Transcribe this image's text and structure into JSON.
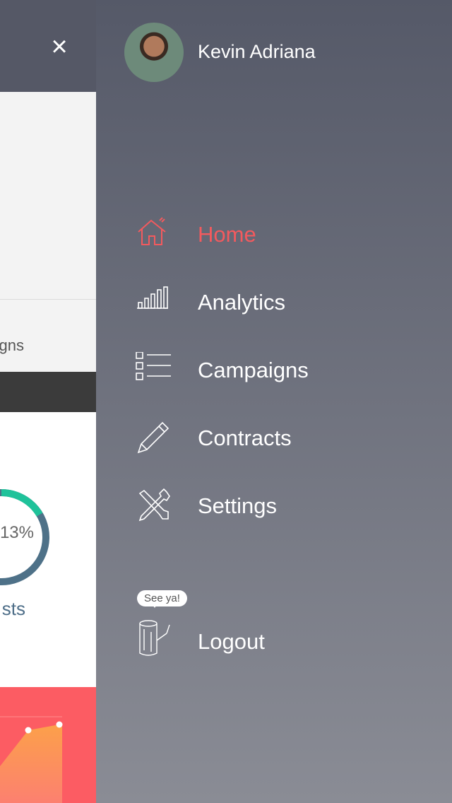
{
  "left_panel": {
    "close_icon": "×",
    "tab_partial": "gns",
    "chevron": ">",
    "donut_percent": "13%",
    "donut_progress": 0.13,
    "donut_label_partial": "sts",
    "colors": {
      "teal": "#1fc29a",
      "ring": "#4e7188",
      "red": "#fc5c63"
    }
  },
  "user": {
    "name": "Kevin Adriana"
  },
  "menu": {
    "items": [
      {
        "label": "Home",
        "icon": "home-icon",
        "active": true
      },
      {
        "label": "Analytics",
        "icon": "bar-chart-icon"
      },
      {
        "label": "Campaigns",
        "icon": "list-icon"
      },
      {
        "label": "Contracts",
        "icon": "pencil-icon"
      },
      {
        "label": "Settings",
        "icon": "tools-icon"
      }
    ]
  },
  "logout": {
    "label": "Logout",
    "bubble": "See ya!",
    "icon": "log-icon"
  },
  "accent": "#f35a5e"
}
